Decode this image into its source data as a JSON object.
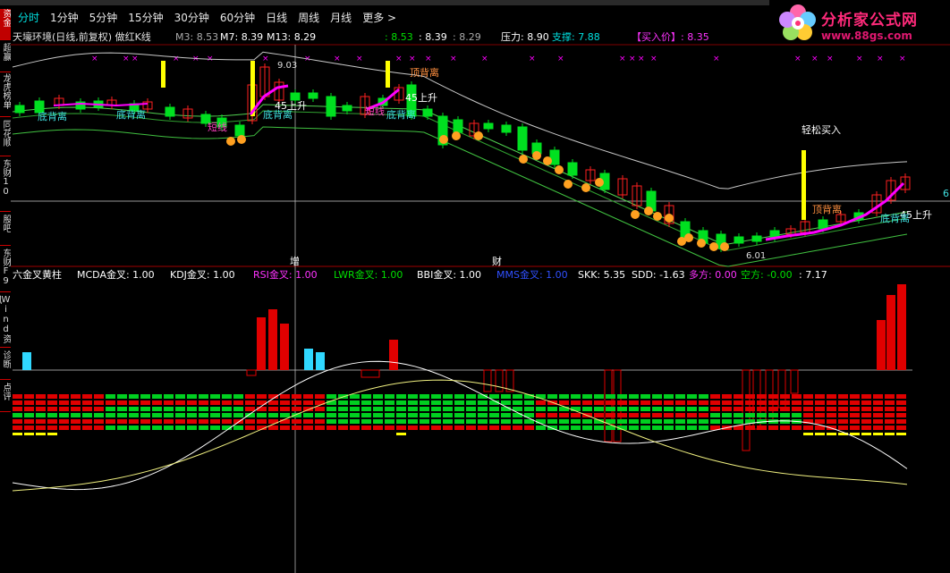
{
  "tabs": [
    "分时",
    "1分钟",
    "5分钟",
    "15分钟",
    "30分钟",
    "60分钟",
    "日线",
    "周线",
    "月线",
    "更多 >"
  ],
  "sidebar": [
    "资金",
    "超赢",
    "龙虎榜单",
    "同花顺",
    "东财10",
    "股吧",
    "东财F9",
    "Wind资讯",
    "诊断",
    "点评"
  ],
  "logo": {
    "title": "分析家公式网",
    "url": "www.88gs.com"
  },
  "main_header": {
    "title": "天壕环境(日线,前复权) 做红K线",
    "m3": "M3: 8.53",
    "m7": "M7: 8.39",
    "m13": "M13: 8.29",
    "v1": ": 8.53",
    "v2": ": 8.39",
    "v3": ": 8.29",
    "pressure": "压力: 8.90",
    "support": "支撑: 7.88",
    "buy_price": "【买入价】: 8.35"
  },
  "sub_header": {
    "name": "六金叉黄柱",
    "macd": "MCDA金叉: 1.00",
    "kdj": "KDJ金叉: 1.00",
    "rsi": "RSI金叉: 1.00",
    "lwr": "LWR金叉: 1.00",
    "bbi": "BBI金叉: 1.00",
    "mms": "MMS金叉: 1.00",
    "skk": "SKK: 5.35",
    "sdd": "SDD: -1.63",
    "duo": "多方: 0.00",
    "kong": "空方: -0.00",
    "last": ": 7.17"
  },
  "annotations": {
    "high_price": "9.03",
    "low_price": "6.01",
    "ding": "顶背离",
    "di": "底背离",
    "duanxian": "短线",
    "up45": "45上升",
    "easy_buy": "轻松买入",
    "zeng": "增",
    "cai": "财",
    "right_edge": "6"
  },
  "colors": {
    "up": "#ff2020",
    "down": "#00e020",
    "yellow": "#ffff00",
    "magenta": "#ff00ff",
    "cyan": "#00e0ff"
  }
}
